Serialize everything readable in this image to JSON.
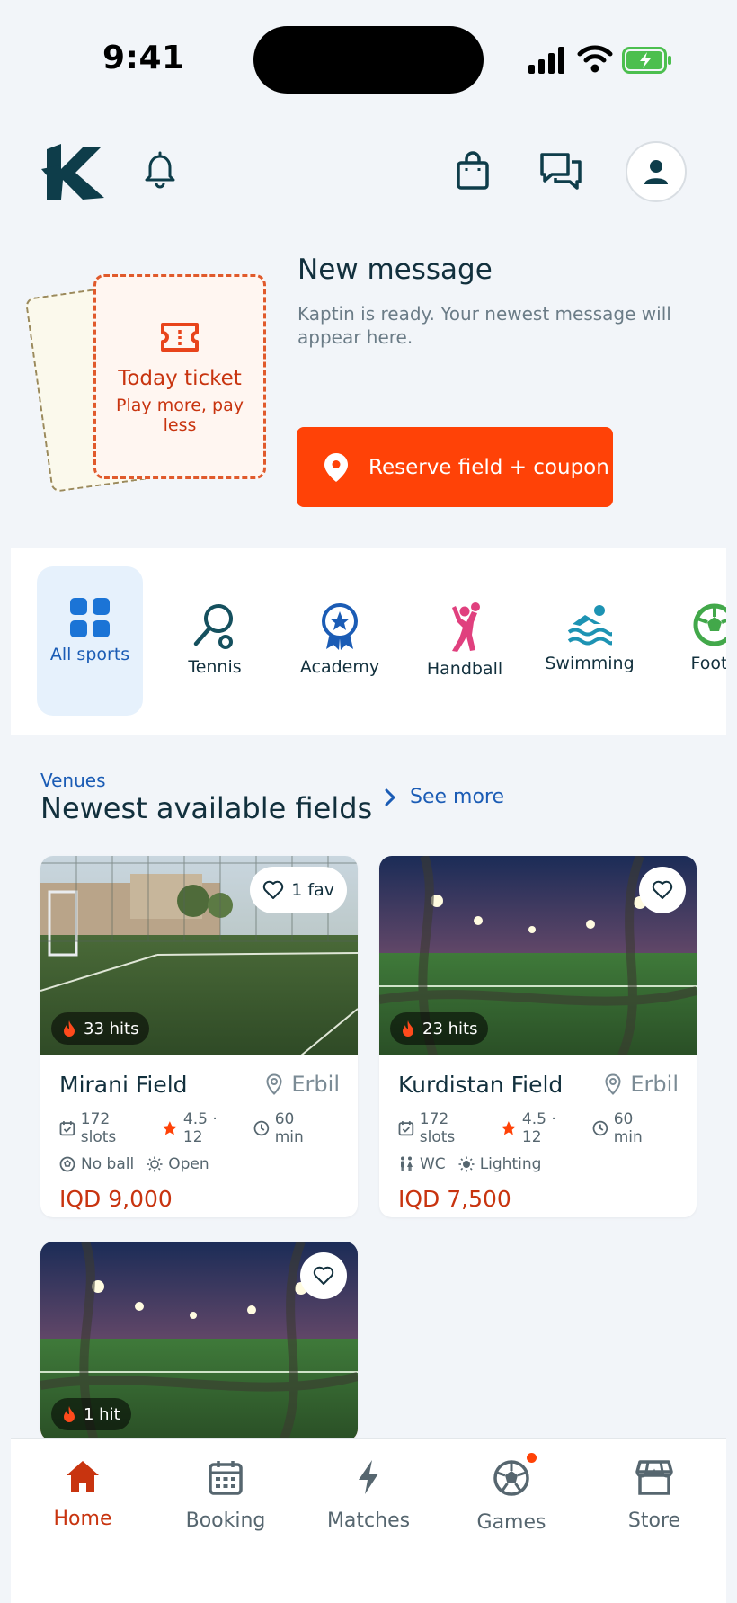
{
  "status_bar": {
    "time": "9:41"
  },
  "promo": {
    "ticket_title": "Today ticket",
    "ticket_subtitle": "Play more, pay less",
    "message_title": "New message",
    "message_text": "Kaptin is ready. Your newest message will appear here.",
    "cta_label": "Reserve field + coupon"
  },
  "categories": [
    {
      "label": "All sports",
      "icon": "grid-icon",
      "active": true
    },
    {
      "label": "Tennis",
      "icon": "tennis-racket-icon"
    },
    {
      "label": "Academy",
      "icon": "medal-icon"
    },
    {
      "label": "Handball",
      "icon": "handball-player-icon"
    },
    {
      "label": "Swimming",
      "icon": "swimmer-icon"
    },
    {
      "label": "Footb",
      "icon": "football-icon"
    }
  ],
  "section": {
    "kicker": "Venues",
    "title": "Newest available fields",
    "see_more": "See more"
  },
  "fields": [
    {
      "name": "Mirani Field",
      "city": "Erbil",
      "fav": "1 fav",
      "hits": "33 hits",
      "slots": "172 slots",
      "rating": "4.5 · 12",
      "duration": "60 min",
      "feature1": "No ball",
      "feature2": "Open",
      "price": "IQD 9,000"
    },
    {
      "name": "Kurdistan Field",
      "city": "Erbil",
      "fav": "",
      "hits": "23 hits",
      "slots": "172 slots",
      "rating": "4.5 · 12",
      "duration": "60 min",
      "feature1": "WC",
      "feature2": "Lighting",
      "price": "IQD 7,500"
    },
    {
      "fav": "",
      "hits": "1 hit"
    }
  ],
  "nav": [
    {
      "label": "Home",
      "icon": "home-icon",
      "active": true
    },
    {
      "label": "Booking",
      "icon": "calendar-icon"
    },
    {
      "label": "Matches",
      "icon": "bolt-icon"
    },
    {
      "label": "Games",
      "icon": "soccer-ball-icon",
      "badge": true
    },
    {
      "label": "Store",
      "icon": "store-icon"
    }
  ],
  "colors": {
    "accent": "#ff4207",
    "brand": "#12303d",
    "link": "#1b5cb5",
    "price": "#c8340f"
  }
}
